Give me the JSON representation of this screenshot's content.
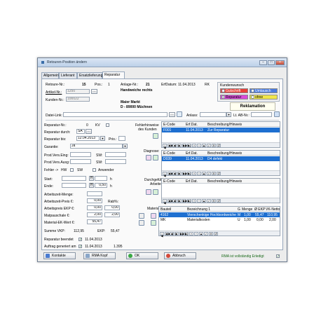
{
  "window": {
    "title": "Retouren-Position ändern",
    "btn_min": "–",
    "btn_max": "□",
    "btn_close": "×"
  },
  "tabs": [
    {
      "label": "Allgemein"
    },
    {
      "label": "Lieferant"
    },
    {
      "label": "Ersatzlieferung"
    },
    {
      "label": "Reparatur"
    }
  ],
  "head": {
    "retoure_label": "Retoure-Nr.:",
    "retoure_value": "15",
    "pos_label": "Pos.:",
    "pos_value": "1",
    "anlage_label": "Anlage-Nr.:",
    "anlage_value": "21",
    "erf_label": "ErfDatum:",
    "erf_value": "11.04.2013",
    "user_value": "RK",
    "artikel_label": "Artikel-Nr.:",
    "artikel_value": "1250",
    "artikel_name": "Handweiche rechts",
    "kunden_label": "Kunden-Nr.:",
    "kunden_value": "100022",
    "kunde_name": "Maier Markt",
    "kunde_ort": "D - 89000 Müchnen",
    "datei_label": "Datei-Link:",
    "anlass_label": "Anlass:",
    "lt_ab_label": "Lt. AB-Nr.:"
  },
  "kundenwunsch": {
    "title": "Kundenwunsch",
    "options": [
      {
        "label": "Gutschrift",
        "color": "#e8413a",
        "checked": false
      },
      {
        "label": "Umtausch",
        "color": "#4a7be0",
        "checked": false
      },
      {
        "label": "Reparatur",
        "color": "#d94bd9",
        "checked": true
      },
      {
        "label": "ohne",
        "color": "#f0e64b",
        "checked": false
      }
    ],
    "reklamation": "Reklamation"
  },
  "rep": {
    "repnr_label": "Reparatur-Nr.:",
    "repnr_value": "0",
    "kv_label": "KV",
    "fehler_label1": "Fehlerhinweise",
    "fehler_label2": "des Kunden",
    "durch_label": "Reparatur durch:",
    "durch_value": "SA",
    "bis_label": "Reparatur bis:",
    "bis_value": "12.04.2013",
    "prio_label": "Prio.:",
    "garantie_label": "Garantie:",
    "garantie_value": "Ja",
    "diagnose_label": "Diagnose:",
    "eing_label": "Prod.Vers.Eing:",
    "sw_label": "SW:",
    "ausg_label": "Prod.Vers.Ausg:",
    "fehler_row_label": "Fehler ->",
    "hw_label": "HW",
    "sw2_label": "SW",
    "anwender_label": "Anwender",
    "start_label": "Start:",
    "ende_label": "Ende:",
    "h_label": "H",
    "h_value": "0,50",
    "h_unit": "h",
    "durch_arb_label1": "Durchgeführte",
    "durch_arb_label2": "Arbeiten:",
    "menge_label": "Arbeitszeit-Menge:",
    "preis_label": "Arbeitszeit-Preis €:",
    "preis_value": "0,00",
    "rab_label": "Rab%:",
    "ek_label": "Arbeitspreis EKP €:",
    "ek_value": "0,00",
    "ek_value2": "0,00",
    "mat_label": "Matpauschale €:",
    "mat_value": "2,00",
    "mat_value2": "2,00",
    "matek_label": "Material-EK-Wert €:",
    "matek_value": "55,47",
    "material_label": "Material:",
    "summe_label": "Summe VKP:",
    "summe_value": "112,95",
    "ekp_label": "EKP:",
    "ekp_value": "55,47",
    "beendet_label": "Reparatur beendet",
    "beendet_value": "11.04.2013",
    "auftrag_label": "Auftrag generiert am",
    "auftrag_value": "11.04.2013",
    "auftrag_nr": "1.395"
  },
  "grid1": {
    "headers": [
      "E-Code",
      "Erf.Dat.",
      "Beschreibung/Hinweis"
    ],
    "rows": [
      [
        "F001",
        "11.04.2013",
        "Zur Reparatur"
      ]
    ]
  },
  "grid2": {
    "headers": [
      "E-Code",
      "Erf.Dat.",
      "Beschreibung/Hinweis"
    ],
    "rows": [
      [
        "D039",
        "11.04.2013",
        "D4 defekt"
      ]
    ]
  },
  "grid3": {
    "headers": [
      "E-Code",
      "Erf.Dat.",
      "Beschreibung/Hinweis"
    ],
    "rows": []
  },
  "grid4": {
    "headers": [
      "Bauteil",
      "Bezeichnung 1",
      "G",
      "Menge",
      "Ø EKP",
      "VK-Netto"
    ],
    "rows": [
      [
        "4162",
        "Vierschenkige Hochbordweiche",
        "M",
        "1,00",
        "55,47",
        "110,95"
      ],
      [
        "MK",
        "Materialkosten",
        "U",
        "1,00",
        "0,00",
        "2,00"
      ]
    ]
  },
  "nav": [
    "|◀",
    "◀◀",
    "◀",
    "▶",
    "▶▶",
    "▶|",
    "+",
    "−",
    "▲",
    "✓",
    "✕",
    "↺"
  ],
  "footer": {
    "kontakte": "Kontakte",
    "rma_kopf": "RMA Kopf",
    "ok": "OK",
    "abbruch": "Abbruch",
    "status": "RMA ist vollständig Erledigt"
  }
}
